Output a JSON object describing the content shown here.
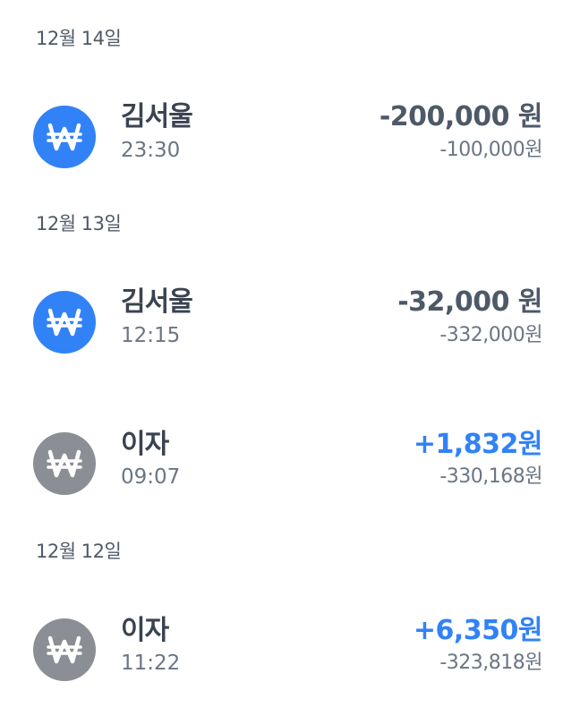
{
  "colors": {
    "icon_transfer": "#3182f6",
    "icon_interest": "#8b8f95",
    "amount_positive": "#3182f6",
    "amount_negative": "#4e5968"
  },
  "groups": [
    {
      "date": "12월 14일",
      "transactions": [
        {
          "name": "김서울",
          "time": "23:30",
          "amount": "-200,000 원",
          "balance": "-100,000원",
          "icon": "won-icon",
          "type": "transfer"
        }
      ]
    },
    {
      "date": "12월 13일",
      "transactions": [
        {
          "name": "김서울",
          "time": "12:15",
          "amount": "-32,000 원",
          "balance": "-332,000원",
          "icon": "won-icon",
          "type": "transfer"
        },
        {
          "name": "이자",
          "time": "09:07",
          "amount": "+1,832원",
          "balance": "-330,168원",
          "icon": "won-icon",
          "type": "interest"
        }
      ]
    },
    {
      "date": "12월 12일",
      "transactions": [
        {
          "name": "이자",
          "time": "11:22",
          "amount": "+6,350원",
          "balance": "-323,818원",
          "icon": "won-icon",
          "type": "interest"
        }
      ]
    }
  ]
}
